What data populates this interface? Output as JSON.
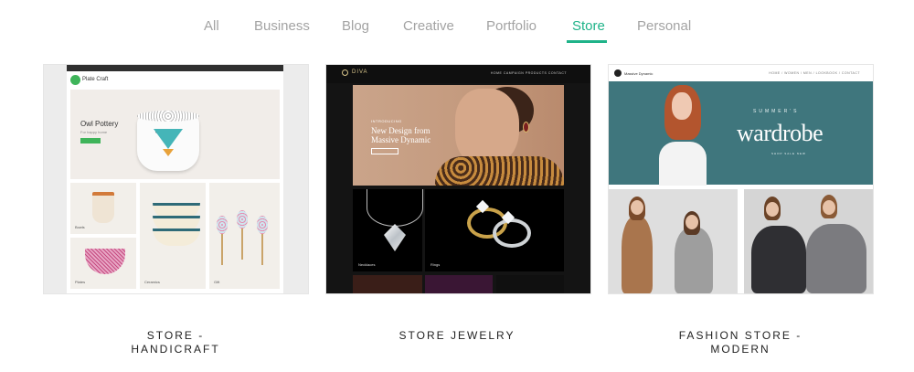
{
  "filter_tabs": [
    {
      "label": "All",
      "active": false
    },
    {
      "label": "Business",
      "active": false
    },
    {
      "label": "Blog",
      "active": false
    },
    {
      "label": "Creative",
      "active": false
    },
    {
      "label": "Portfolio",
      "active": false
    },
    {
      "label": "Store",
      "active": true
    },
    {
      "label": "Personal",
      "active": false
    }
  ],
  "accent_color": "#1fb389",
  "cards": [
    {
      "caption_line1": "STORE -",
      "caption_line2": "HANDICRAFT",
      "preview": {
        "logo": "Plate Craft",
        "hero_title": "Owl Pottery",
        "hero_sub": "For happy home",
        "tiles": [
          "Bowls",
          "Ceramics",
          "Gift",
          "Plates"
        ]
      }
    },
    {
      "caption_line1": "STORE JEWELRY",
      "caption_line2": "",
      "preview": {
        "logo": "DIVA",
        "nav": "HOME   CAMPAIGN   PRODUCTS   CONTACT",
        "eyebrow": "INTRODUCING",
        "hero_line1": "New Design from",
        "hero_line2": "Massive Dynamic",
        "tiles": [
          "Necklaces",
          "Rings"
        ]
      }
    },
    {
      "caption_line1": "FASHION STORE -",
      "caption_line2": "MODERN",
      "preview": {
        "brand": "Massive Dynamic",
        "nav": "HOME  /  WOMEN  /  MEN  /  LOOKBOOK  /  CONTACT",
        "hero_sub": "SUMMER'S",
        "hero_title": "wardrobe",
        "hero_links": "SHOP  SALE  NEW"
      }
    }
  ]
}
